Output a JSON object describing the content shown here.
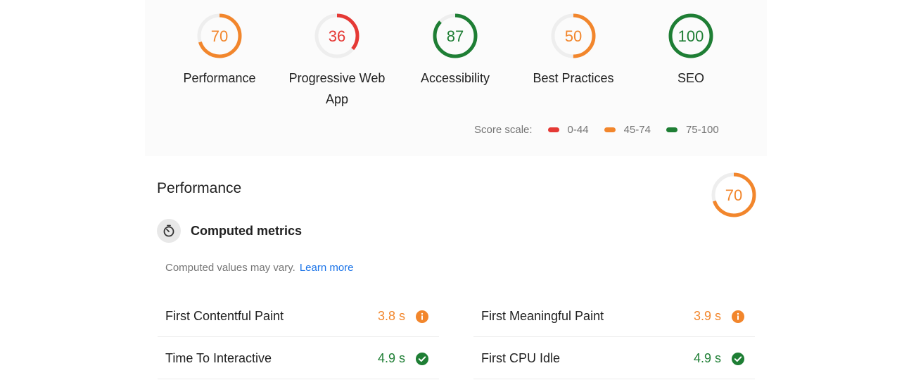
{
  "colors": {
    "fail": "#e53935",
    "average": "#f2862c",
    "pass": "#1e7e34",
    "ring_bg": "#eeeeee",
    "link": "#1a73e8"
  },
  "categories": [
    {
      "label": "Performance",
      "score": 70,
      "status": "average"
    },
    {
      "label": "Progressive Web App",
      "score": 36,
      "status": "fail"
    },
    {
      "label": "Accessibility",
      "score": 87,
      "status": "pass"
    },
    {
      "label": "Best Practices",
      "score": 50,
      "status": "average"
    },
    {
      "label": "SEO",
      "score": 100,
      "status": "pass"
    }
  ],
  "scale": {
    "label": "Score scale:",
    "ranges": [
      {
        "label": "0-44",
        "status": "fail"
      },
      {
        "label": "45-74",
        "status": "average"
      },
      {
        "label": "75-100",
        "status": "pass"
      }
    ]
  },
  "performance": {
    "title": "Performance",
    "score": 70,
    "status": "average",
    "section_title": "Computed metrics",
    "section_icon": "timer-icon",
    "note": "Computed values may vary.",
    "learn_more": "Learn more",
    "metrics": [
      {
        "name": "First Contentful Paint",
        "value": "3.8 s",
        "status": "average",
        "icon": "info-icon"
      },
      {
        "name": "First Meaningful Paint",
        "value": "3.9 s",
        "status": "average",
        "icon": "info-icon"
      },
      {
        "name": "Time To Interactive",
        "value": "4.9 s",
        "status": "pass",
        "icon": "check-circle-icon"
      },
      {
        "name": "First CPU Idle",
        "value": "4.9 s",
        "status": "pass",
        "icon": "check-circle-icon"
      }
    ]
  }
}
